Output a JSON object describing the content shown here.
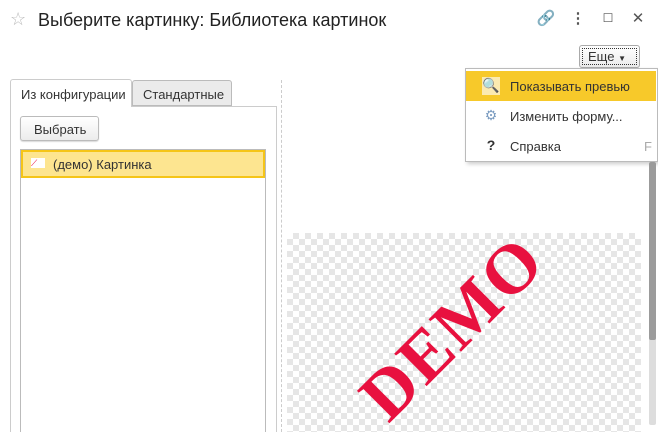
{
  "window": {
    "title": "Выберите картинку: Библиотека картинок"
  },
  "header": {
    "more_label": "Еще"
  },
  "menu": {
    "items": [
      {
        "label": "Показывать превью",
        "shortcut": ""
      },
      {
        "label": "Изменить форму...",
        "shortcut": ""
      },
      {
        "label": "Справка",
        "shortcut": "F"
      }
    ]
  },
  "tabs": [
    {
      "label": "Из конфигурации"
    },
    {
      "label": "Стандартные"
    }
  ],
  "select_button": "Выбрать",
  "list": {
    "items": [
      {
        "label": "(демо) Картинка"
      }
    ]
  },
  "preview": {
    "watermark": "DEMO"
  },
  "colors": {
    "accent": "#f5c518",
    "selection": "#fde590",
    "demo": "#e8113f"
  }
}
